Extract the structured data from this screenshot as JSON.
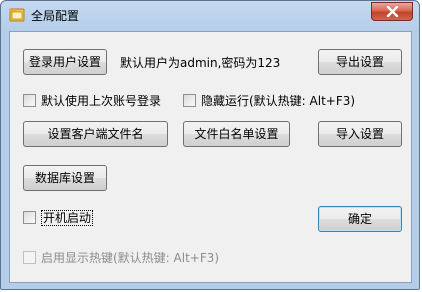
{
  "window": {
    "title": "全局配置",
    "close_icon": "close-icon",
    "app_icon": "folder-window-icon"
  },
  "login_user_button": "登录用户设置",
  "default_user_text": "默认用户为admin,密码为123",
  "export_button": "导出设置",
  "checkboxes": {
    "use_last_account": {
      "label": "默认使用上次账号登录",
      "checked": false,
      "enabled": true
    },
    "hide_run": {
      "label": "隐藏运行(默认热键: Alt+F3)",
      "checked": false,
      "enabled": true
    },
    "startup": {
      "label": "开机启动",
      "checked": false,
      "enabled": true
    },
    "enable_show_hotkey": {
      "label": "启用显示热键(默认热键: Alt+F3)",
      "checked": false,
      "enabled": false
    }
  },
  "client_file_button": "设置客户端文件名",
  "file_whitelist_button": "文件白名单设置",
  "import_button": "导入设置",
  "database_button": "数据库设置",
  "ok_button": "确定"
}
